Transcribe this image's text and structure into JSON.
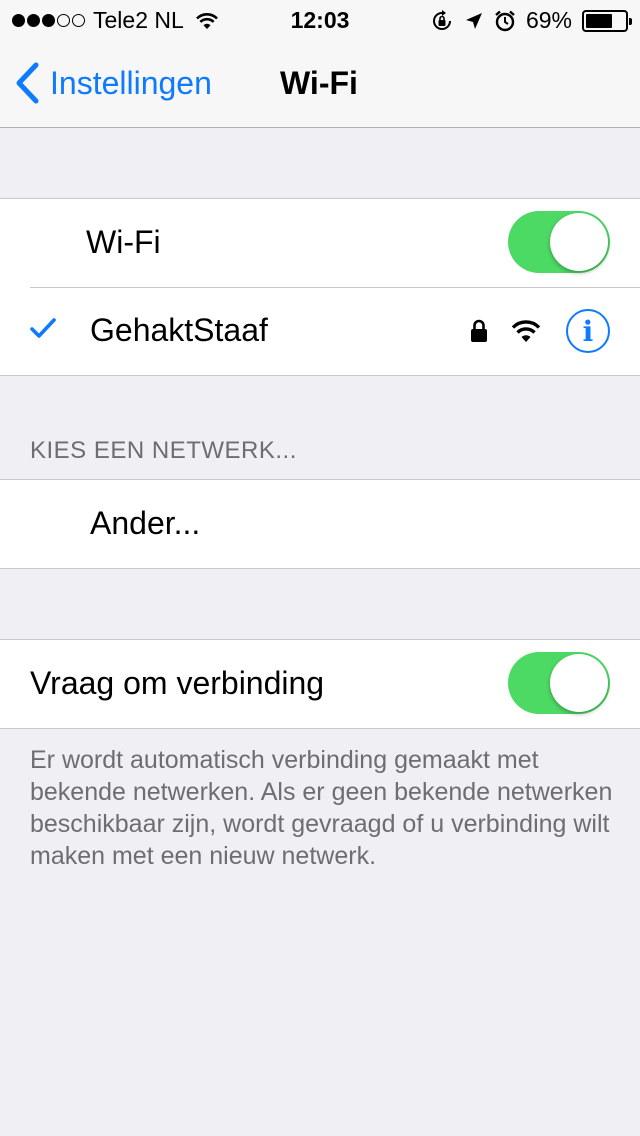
{
  "status_bar": {
    "signal_full": 3,
    "signal_total": 5,
    "carrier": "Tele2 NL",
    "time": "12:03",
    "battery_percent": "69%",
    "battery_level": 0.69,
    "icons": [
      "wifi-icon",
      "orientation-lock-icon",
      "location-icon",
      "alarm-icon",
      "battery-icon"
    ]
  },
  "nav": {
    "back_label": "Instellingen",
    "title": "Wi-Fi",
    "accent_color": "#0e7afe"
  },
  "wifi_group": {
    "wifi_label": "Wi-Fi",
    "wifi_toggle_on": true,
    "connected_network": "GehaktStaaf",
    "info_glyph": "i"
  },
  "choose_network": {
    "header": "KIES EEN NETWERK...",
    "other_label": "Ander..."
  },
  "ask_join": {
    "label": "Vraag om verbinding",
    "toggle_on": true,
    "footer": "Er wordt automatisch verbinding gemaakt met bekende netwerken. Als er geen bekende netwerken beschikbaar zijn, wordt gevraagd of u verbinding wilt maken met een nieuw netwerk."
  },
  "colors": {
    "toggle_on": "#4cd964",
    "background": "#efeff4",
    "secondary_text": "#6d6d72"
  }
}
